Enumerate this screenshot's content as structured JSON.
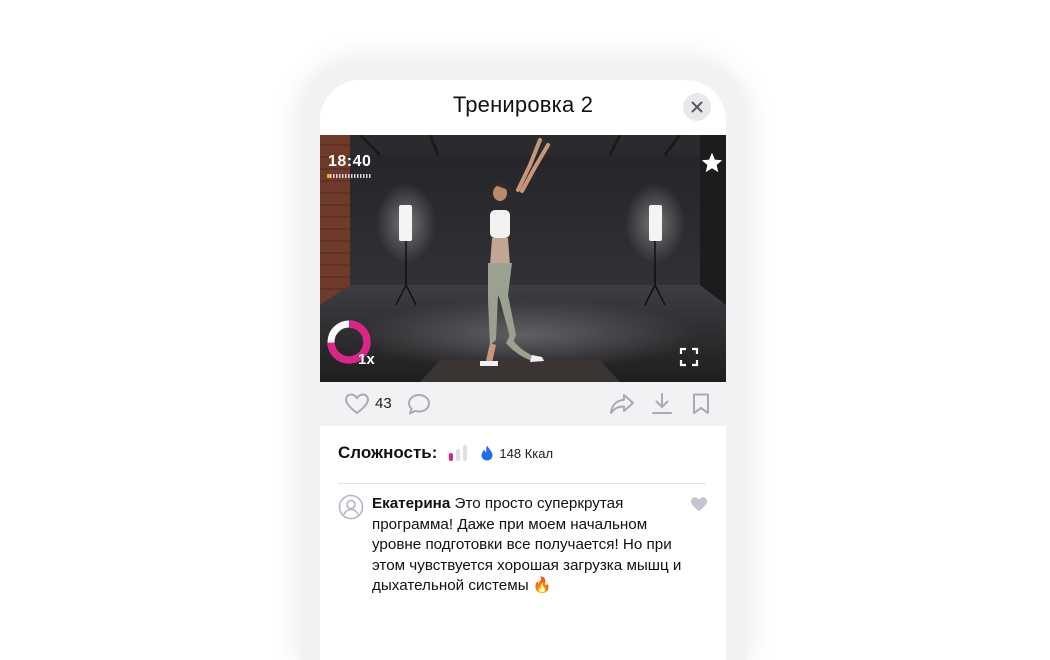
{
  "header": {
    "title": "Тренировка 2",
    "close_icon": "close-icon"
  },
  "video": {
    "timer": "18:40",
    "speed": "1x",
    "icons": [
      "star-icon",
      "fullscreen-icon",
      "speed-ring-icon"
    ]
  },
  "actions": {
    "likes": "43",
    "icons": [
      "heart-outline-icon",
      "comment-icon",
      "share-icon",
      "download-icon",
      "bookmark-icon"
    ]
  },
  "info": {
    "difficulty_label": "Сложность:",
    "difficulty_level": 1,
    "difficulty_max": 3,
    "calories": "148 Ккал",
    "accent_color": "#e0218a",
    "flame_color": "#1e6cf0"
  },
  "comment": {
    "author": "Екатерина",
    "text": "Это просто суперкрутая программа! Даже при моем начальном уровне подготовки все получается! Но при этом чувствуется хорошая загрузка мышц и дыхательной системы 🔥"
  }
}
